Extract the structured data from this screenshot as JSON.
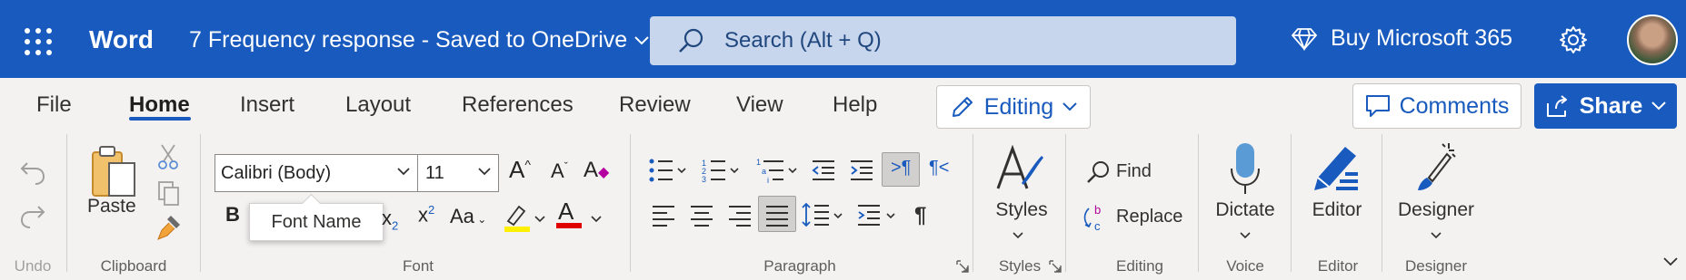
{
  "titlebar": {
    "app_name": "Word",
    "doc_title": "7 Frequency response  -  Saved to OneDrive",
    "search_placeholder": "Search (Alt + Q)",
    "buy_label": "Buy Microsoft 365"
  },
  "tabs": [
    {
      "label": "File"
    },
    {
      "label": "Home"
    },
    {
      "label": "Insert"
    },
    {
      "label": "Layout"
    },
    {
      "label": "References"
    },
    {
      "label": "Review"
    },
    {
      "label": "View"
    },
    {
      "label": "Help"
    }
  ],
  "active_tab": "Home",
  "mode_button": "Editing",
  "comments_label": "Comments",
  "share_label": "Share",
  "ribbon": {
    "undo_group": "Undo",
    "clipboard": {
      "paste_label": "Paste",
      "group": "Clipboard"
    },
    "font": {
      "font_name": "Calibri (Body)",
      "font_size": "11",
      "tooltip": "Font Name",
      "bold": "B",
      "superscript": "x",
      "superscript_exp": "2",
      "subscript": "x",
      "subscript_exp": "2",
      "change_case": "Aa",
      "font_color_letter": "A",
      "grow": "A",
      "shrink": "A",
      "clear": "A",
      "highlight_color": "#ffef00",
      "font_color": "#e00000",
      "group": "Font"
    },
    "paragraph": {
      "group": "Paragraph"
    },
    "styles": {
      "label": "Styles",
      "group": "Styles"
    },
    "editing": {
      "find": "Find",
      "replace": "Replace",
      "group": "Editing"
    },
    "voice": {
      "dictate": "Dictate",
      "group": "Voice"
    },
    "editor": {
      "label": "Editor",
      "group": "Editor"
    },
    "designer": {
      "label": "Designer",
      "group": "Designer"
    }
  },
  "colors": {
    "brand": "#185abd",
    "search_bg": "#c7d6ec",
    "ribbon_bg": "#f3f2f1"
  }
}
